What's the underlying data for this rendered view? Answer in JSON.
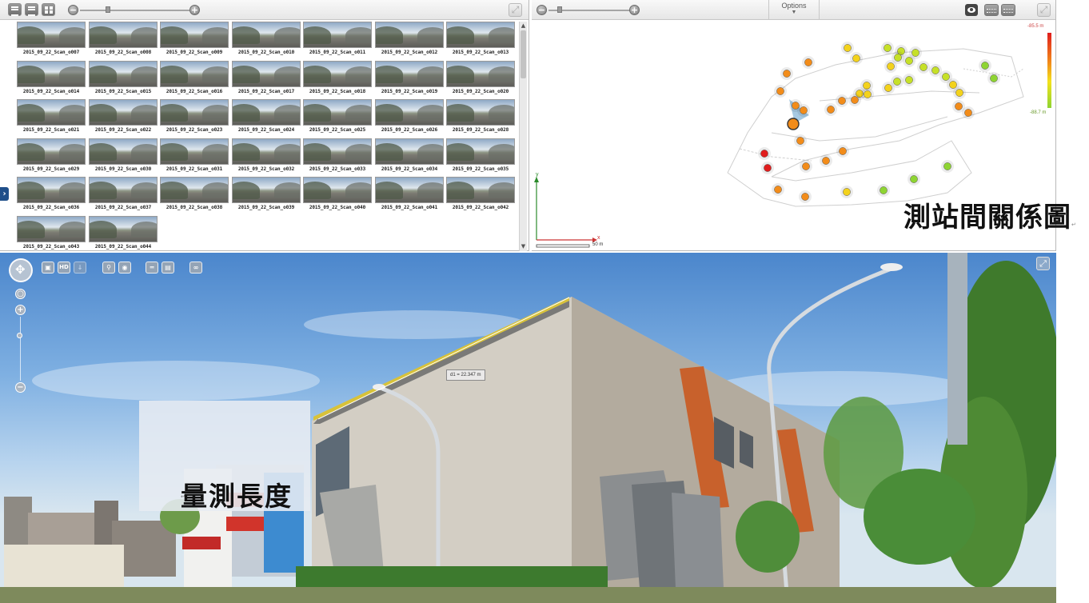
{
  "thumbnails": {
    "items": [
      "2015_09_22_Scan_o007",
      "2015_09_22_Scan_o008",
      "2015_09_22_Scan_o009",
      "2015_09_22_Scan_o010",
      "2015_09_22_Scan_o011",
      "2015_09_22_Scan_o012",
      "2015_09_22_Scan_o013",
      "2015_09_22_Scan_o014",
      "2015_09_22_Scan_o015",
      "2015_09_22_Scan_o016",
      "2015_09_22_Scan_o017",
      "2015_09_22_Scan_o018",
      "2015_09_22_Scan_o019",
      "2015_09_22_Scan_o020",
      "2015_09_22_Scan_o021",
      "2015_09_22_Scan_o022",
      "2015_09_22_Scan_o023",
      "2015_09_22_Scan_o024",
      "2015_09_22_Scan_o025",
      "2015_09_22_Scan_o026",
      "2015_09_22_Scan_o028",
      "2015_09_22_Scan_o029",
      "2015_09_22_Scan_o030",
      "2015_09_22_Scan_o031",
      "2015_09_22_Scan_o032",
      "2015_09_22_Scan_o033",
      "2015_09_22_Scan_o034",
      "2015_09_22_Scan_o035",
      "2015_09_22_Scan_o036",
      "2015_09_22_Scan_o037",
      "2015_09_22_Scan_o038",
      "2015_09_22_Scan_o039",
      "2015_09_22_Scan_o040",
      "2015_09_22_Scan_o041",
      "2015_09_22_Scan_o042",
      "2015_09_22_Scan_o043",
      "2015_09_22_Scan_o044"
    ]
  },
  "map": {
    "options_label": "Options",
    "legend_max": "-85.5 m",
    "legend_min": "-88.7 m",
    "scale_label": "50 m",
    "axis_y": "y",
    "axis_x": "x"
  },
  "annotations": {
    "station_relation": "測站間關係圖",
    "measure_length": "量測長度",
    "paragraph_mark": "↵"
  },
  "panorama": {
    "measurement": "d1 = 22.347 m",
    "hd_label": "HD"
  },
  "icons": {
    "list_view": "list-view-icon",
    "detail_view": "detail-view-icon",
    "grid_view": "grid-view-icon",
    "zoom_out": "zoom-out-icon",
    "zoom_in": "zoom-in-icon",
    "maximize": "maximize-icon",
    "eye": "eye-icon",
    "ruler": "ruler-icon",
    "navigation": "navigation-ring-icon",
    "location_pin": "location-pin-icon",
    "link": "link-icon"
  },
  "colors": {
    "station_high": "#e01d1d",
    "station_mid": "#f28c1a",
    "station_low": "#8ed432",
    "panel_border": "#b9b9b9"
  }
}
